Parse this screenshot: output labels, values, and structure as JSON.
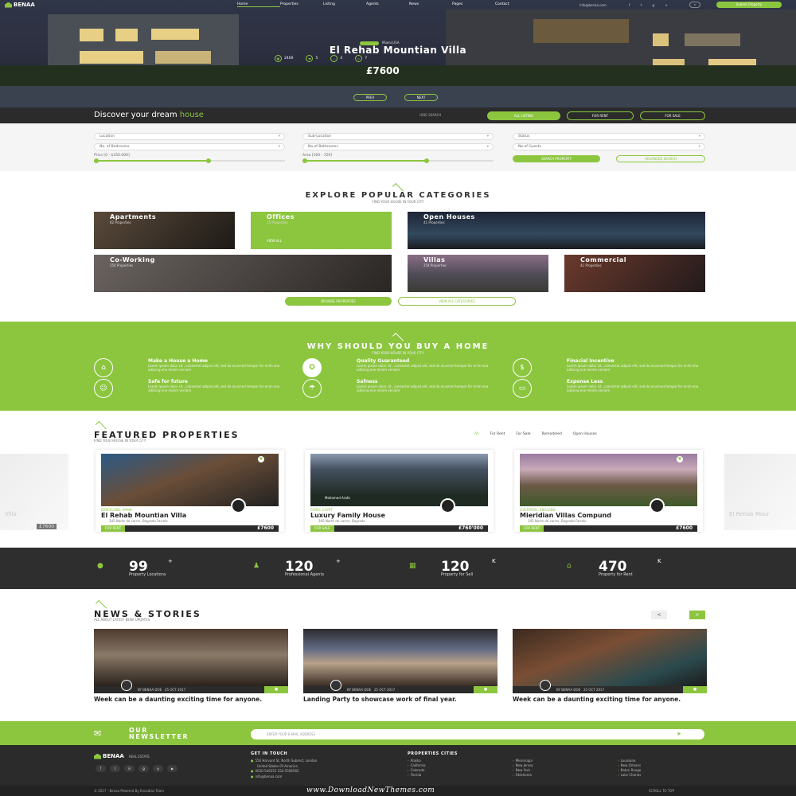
{
  "nav": {
    "brand": "BENAA",
    "links": [
      "Home",
      "Properties",
      "Listing",
      "Agents",
      "News",
      "Pages",
      "Contact"
    ],
    "contact": "info@benaa.com",
    "cta": "Submit Property"
  },
  "hero": {
    "tag": "Miami,USA",
    "title": "El Rehab Mountian Villa",
    "stats": [
      "2400",
      "5",
      "4",
      "7"
    ],
    "price": "£7600",
    "prev": "PREV",
    "next": "NEXT"
  },
  "search": {
    "discover_prefix": "Discover your dream",
    "discover_highlight": "house",
    "hide": "HIDE SEARCH",
    "tabs": [
      "ALL LISTING",
      "FOR RENT",
      "FOR SALE"
    ],
    "fields": {
      "location": "Location",
      "sublocation": "Sub-Location",
      "status": "Status",
      "bedrooms": "No. of Bedrooms",
      "bathrooms": "No.of Bathrooms",
      "guests": "No.of Guests"
    },
    "price_label": "Price [0 - $350.000]",
    "area_label": "Area [160 - 720]",
    "price_fill": 0.6,
    "area_fill": 0.65,
    "search_btn": "SEARCH PROPERTY",
    "advanced_btn": "ADVANCED SEARCH"
  },
  "categories": {
    "title": "EXPLORE POPULAR CATEGORIES",
    "subtitle": "FIND YOUR HOUSE IN YOUR CITY",
    "items": [
      {
        "name": "Apartments",
        "count": "82 Properties"
      },
      {
        "name": "Offices",
        "count": "15 Properties",
        "view": "VIEW ALL"
      },
      {
        "name": "Open Houses",
        "count": "41 Properties"
      },
      {
        "name": "Co-Working",
        "count": "254 Properties"
      },
      {
        "name": "Villas",
        "count": "254 Properties"
      },
      {
        "name": "Commercial",
        "count": "41 Properties"
      }
    ],
    "browse_btn": "BROWSE PROPERTIES",
    "view_all_btn": "VIEW ALL CATEGORIES"
  },
  "why": {
    "title": "WHY SHOULD YOU BUY A HOME",
    "subtitle": "FIND YOUR HOUSE IN YOUR CITY",
    "desc": "Lorem ipsum dolor sit , consectet adipisi elit, sed do eiusmod tempor for enim ena adilsing ene minim veniam",
    "features": [
      {
        "title": "Make a House a Home",
        "icon": "house-icon"
      },
      {
        "title": "Quality Guaranteed",
        "icon": "quality-icon"
      },
      {
        "title": "Finacial Incentive",
        "icon": "dollar-icon"
      },
      {
        "title": "Safe for future",
        "icon": "family-icon"
      },
      {
        "title": "Safness",
        "icon": "umbrella-icon"
      },
      {
        "title": "Expense Less",
        "icon": "money-icon"
      }
    ]
  },
  "featured": {
    "title": "FEATURED PROPERTIES",
    "subtitle": "FIND YOUR HOUSE IN YOUR CITY",
    "filters": [
      "All",
      "For Rent",
      "For Sale",
      "Remodeled",
      "Open Houses"
    ],
    "cards": [
      {
        "location": "BARCELONA, SPAIN",
        "name": "El Rehab Mountian Villa",
        "address": "345 Norte de carrer, Bogrado Farrelo",
        "tag": "FOR RENT",
        "price": "£7600"
      },
      {
        "location": "CAIRO, EGYPT",
        "name": "Luxury Family House",
        "address": "345 Norte de carrer, Bogrado",
        "tag": "FOR SALE",
        "price": "£760'000",
        "agent": "Mohamed Arafa"
      },
      {
        "location": "LIVERPOOL, ENGLAND",
        "name": "Mieridian Villas Compund",
        "address": "345 Norte de carrer, Bogrado Farrelo",
        "tag": "FOR RENT",
        "price": "£7600"
      }
    ],
    "side_left": "Villa",
    "side_left_price": "£7600",
    "side_right": "El Rehab Mour"
  },
  "counters": [
    {
      "num": "99",
      "sup": "+",
      "label": "Property Locations"
    },
    {
      "num": "120",
      "sup": "+",
      "label": "Professional Agents"
    },
    {
      "num": "120",
      "sup": "K",
      "label": "Property for Sell"
    },
    {
      "num": "470",
      "sup": "K",
      "label": "Property for Rent"
    }
  ],
  "news": {
    "title": "NEWS & STORIES",
    "subtitle": "ALL ABOUT LATEST BENA UPDATES",
    "prev": "<",
    "next": ">",
    "items": [
      {
        "author": "BY BENAA DOE",
        "date": "25 OCT 2017",
        "title": "Week can be a daunting exciting time for anyone."
      },
      {
        "author": "BY BENAA DOE",
        "date": "25 OCT 2017",
        "title": "Landing Party to showcase work of final year."
      },
      {
        "author": "BY BENAA DOE",
        "date": "25 OCT 2017",
        "title": "Week can be a daunting exciting time for anyone."
      }
    ]
  },
  "newsletter": {
    "title1": "OUR",
    "title2": "NEWSLETTER",
    "placeholder": "ENTER YOUR E-MAIL ADDRESS"
  },
  "footer": {
    "brand": "BENAA",
    "brand_sub": "REAL ESTATE",
    "contact_title": "GET IN TOUCH",
    "contact_lines": [
      "550 Harvard St, North Subrect, London",
      "United States Of America",
      "0020-546555  254-5566565",
      "info@benaa.com"
    ],
    "cities_title": "PROPERTIES CITIES",
    "cities_col1": [
      "Alaska",
      "California",
      "Colorado",
      "Florida"
    ],
    "cities_col2": [
      "Mississippi",
      "New Jersey",
      "New York",
      "Oklahoma"
    ],
    "cities_col3": [
      "Louisiana",
      "New Orleans",
      "Baton Rouge",
      "Lake Charles"
    ],
    "copyright": "© 2017 - Benaa Powered By Encodiax Team",
    "watermark": "www.DownloadNewThemes.com",
    "to_top": "SCROLL TO TOP"
  },
  "colors": {
    "accent": "#8cc63f",
    "dark": "#2b2b2b"
  }
}
